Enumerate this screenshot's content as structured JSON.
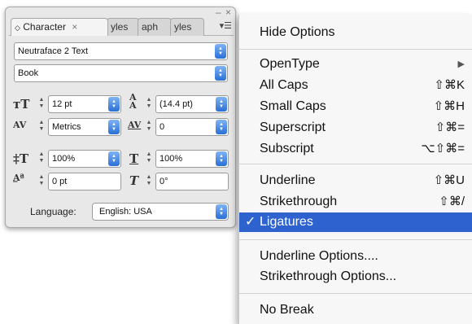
{
  "panel": {
    "tabs": {
      "character": "Character",
      "t2": "yles",
      "t3": "aph",
      "t4": "yles"
    },
    "font_family": "Neutraface 2 Text",
    "font_style": "Book",
    "font_size": "12 pt",
    "leading": "(14.4 pt)",
    "kerning": "Metrics",
    "tracking": "0",
    "vertical_scale": "100%",
    "horizontal_scale": "100%",
    "baseline_shift": "0 pt",
    "skew": "0°",
    "language_label": "Language:",
    "language_value": "English: USA"
  },
  "menu": {
    "hide_options": "Hide Options",
    "opentype": "OpenType",
    "all_caps": "All Caps",
    "all_caps_shortcut": "⇧⌘K",
    "small_caps": "Small Caps",
    "small_caps_shortcut": "⇧⌘H",
    "superscript": "Superscript",
    "superscript_shortcut": "⇧⌘=",
    "subscript": "Subscript",
    "subscript_shortcut": "⌥⇧⌘=",
    "underline": "Underline",
    "underline_shortcut": "⇧⌘U",
    "strikethrough": "Strikethrough",
    "strikethrough_shortcut": "⇧⌘/",
    "ligatures": "Ligatures",
    "underline_options": "Underline Options....",
    "strikethrough_options": "Strikethrough Options...",
    "no_break": "No Break"
  },
  "colors": {
    "selection": "#2d62cf",
    "popup_button": "#2a6fd6"
  }
}
